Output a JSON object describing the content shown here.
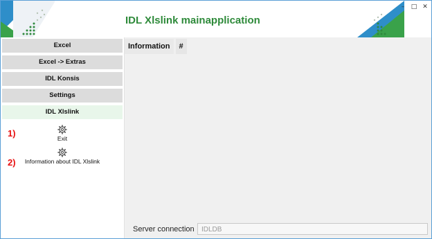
{
  "app": {
    "title": "IDL Xlslink mainapplication"
  },
  "window_controls": [
    "–",
    "□",
    "✕"
  ],
  "sidebar": {
    "items": [
      {
        "label": "Excel"
      },
      {
        "label": "Excel -> Extras"
      },
      {
        "label": "IDL Konsis"
      },
      {
        "label": "Settings"
      },
      {
        "label": "IDL Xlslink"
      }
    ],
    "active_index": 4,
    "actions": [
      {
        "label": "Exit",
        "icon": "gear-icon"
      },
      {
        "label": "Information about IDL Xlslink",
        "icon": "gear-icon"
      }
    ],
    "markers": [
      "1)",
      "2)"
    ]
  },
  "main": {
    "tabs": [
      {
        "label": "Information"
      },
      {
        "label": "#"
      }
    ]
  },
  "status": {
    "server_label": "Server connection",
    "server_value": "IDLDB"
  },
  "colors": {
    "accent_green": "#2e8a3a",
    "active_nav": "#e8f6ea",
    "marker_red": "#e81010"
  }
}
